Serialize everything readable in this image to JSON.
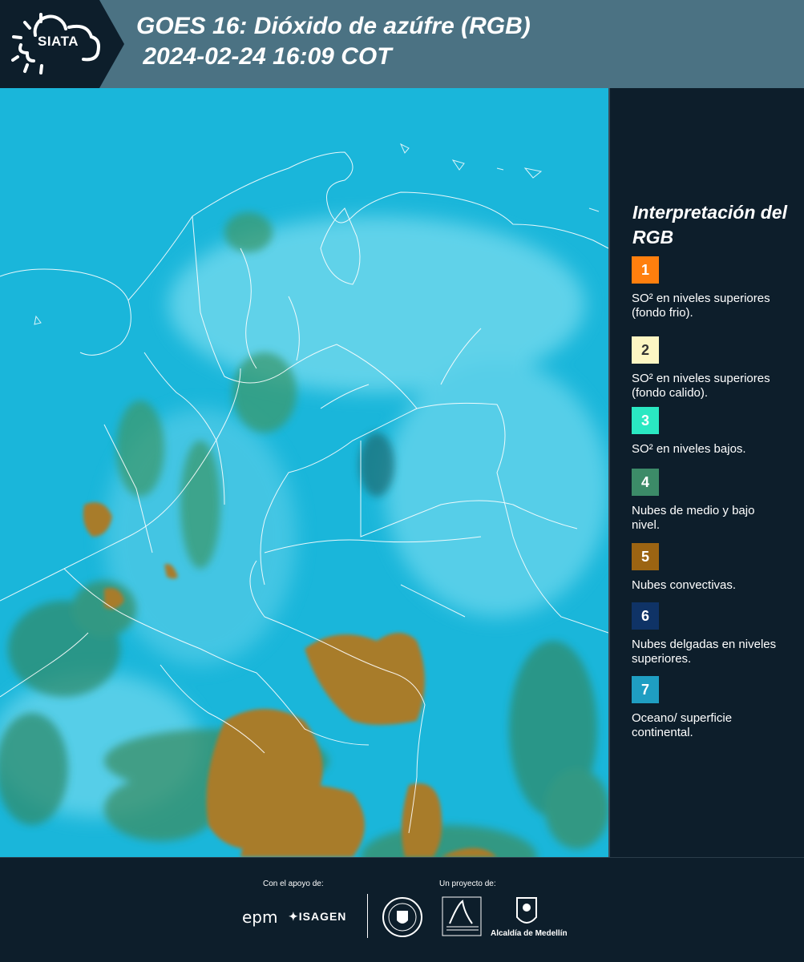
{
  "header": {
    "logo_text": "SIATA",
    "title": "GOES 16: Dióxido de azúfre (RGB)\n 2024-02-24 16:09 COT"
  },
  "legend": {
    "title": "Interpretación del RGB",
    "items": [
      {
        "number": "1",
        "color": "#ff7f0e",
        "label": "SO² en niveles superiores (fondo frio)."
      },
      {
        "number": "2",
        "color": "#fdf6c3",
        "label": "SO² en niveles superiores (fondo calido)."
      },
      {
        "number": "3",
        "color": "#2ae8c2",
        "label": "SO² en niveles bajos."
      },
      {
        "number": "4",
        "color": "#3c8b68",
        "label": "Nubes de medio y bajo nivel."
      },
      {
        "number": "5",
        "color": "#9c6412",
        "label": "Nubes convectivas."
      },
      {
        "number": "6",
        "color": "#0f3366",
        "label": "Nubes delgadas en niveles superiores."
      },
      {
        "number": "7",
        "color": "#1f9ec2",
        "label": "Oceano/ superficie continental."
      }
    ]
  },
  "footer": {
    "support_label": "Con el apoyo de:",
    "project_label": "Un proyecto de:",
    "sponsors": [
      "epm",
      "ISAGEN"
    ],
    "partners": [
      "Área Metropolitana Valle de Aburrá",
      "Alcaldía de Medellín"
    ],
    "alcaldia_label": "Alcaldía de Medellín"
  }
}
